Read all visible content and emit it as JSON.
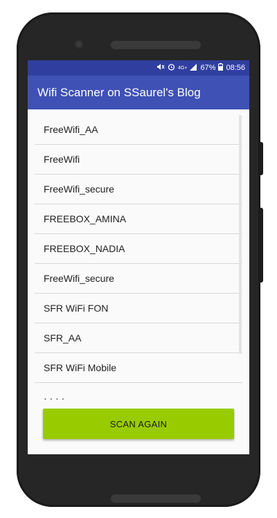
{
  "status_bar": {
    "icons": [
      "mute-icon",
      "alarm-icon",
      "network-4g-icon",
      "signal-icon",
      "battery-icon"
    ],
    "network_label": "4G+",
    "battery_percent": "67%",
    "time": "08:56"
  },
  "app_bar": {
    "title": "Wifi Scanner on SSaurel's Blog",
    "color": "#3f51b5",
    "status_color": "#303f9f"
  },
  "wifi_list": {
    "items": [
      "FreeWifi_AA",
      "FreeWifi",
      "FreeWifi_secure",
      "FREEBOX_AMINA",
      "FREEBOX_NADIA",
      "FreeWifi_secure",
      "SFR WiFi FON",
      "SFR_AA",
      "SFR WiFi Mobile",
      "· · · ·"
    ]
  },
  "scan_button": {
    "label": "SCAN AGAIN",
    "color": "#99cc00"
  }
}
